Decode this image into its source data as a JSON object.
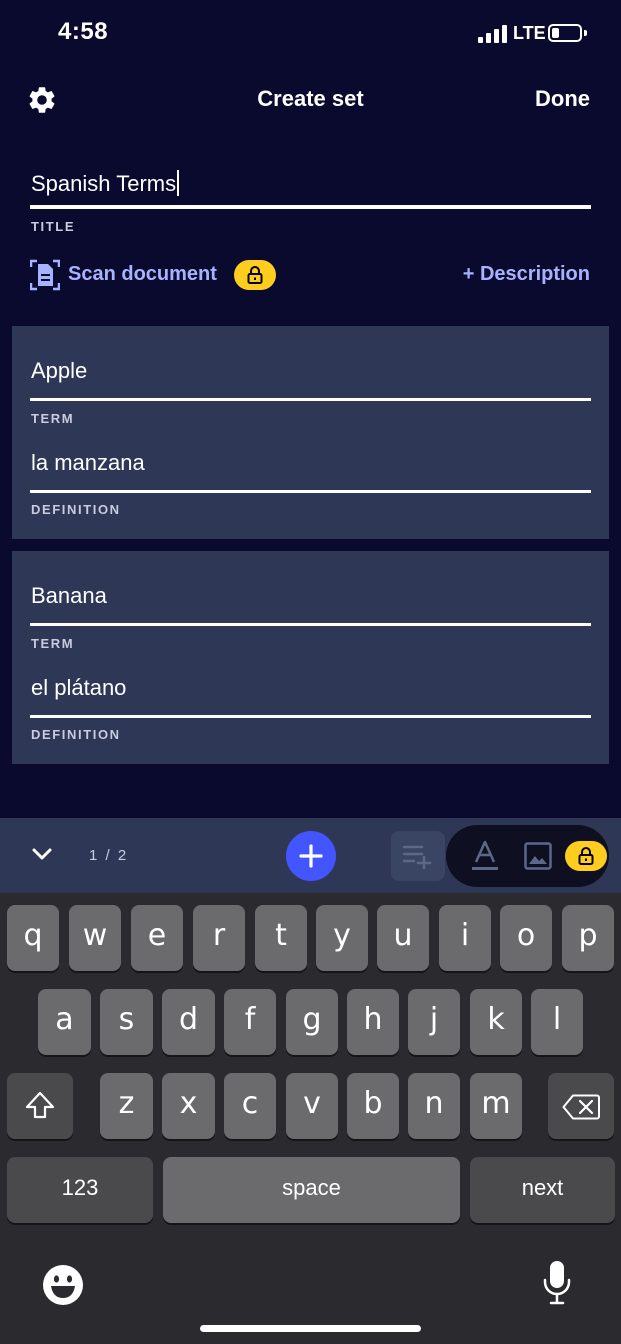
{
  "status": {
    "time": "4:58",
    "network": "LTE"
  },
  "nav": {
    "title": "Create set",
    "done": "Done"
  },
  "title_field": {
    "value": "Spanish Terms",
    "label": "TITLE"
  },
  "scan": {
    "label": "Scan document"
  },
  "description_link": "+ Description",
  "cards": [
    {
      "term": "Apple",
      "term_label": "TERM",
      "definition": "la manzana",
      "definition_label": "DEFINITION"
    },
    {
      "term": "Banana",
      "term_label": "TERM",
      "definition": "el plátano",
      "definition_label": "DEFINITION"
    }
  ],
  "toolbar": {
    "counter": "1 / 2"
  },
  "keyboard": {
    "row1": [
      "q",
      "w",
      "e",
      "r",
      "t",
      "y",
      "u",
      "i",
      "o",
      "p"
    ],
    "row2": [
      "a",
      "s",
      "d",
      "f",
      "g",
      "h",
      "j",
      "k",
      "l"
    ],
    "row3": [
      "z",
      "x",
      "c",
      "v",
      "b",
      "n",
      "m"
    ],
    "numbers": "123",
    "space": "space",
    "next": "next"
  },
  "colors": {
    "background": "#0a0a2e",
    "card": "#2e3856",
    "accent": "#4255ff",
    "link": "#a8b3ff",
    "lock_badge": "#ffcd1f"
  }
}
